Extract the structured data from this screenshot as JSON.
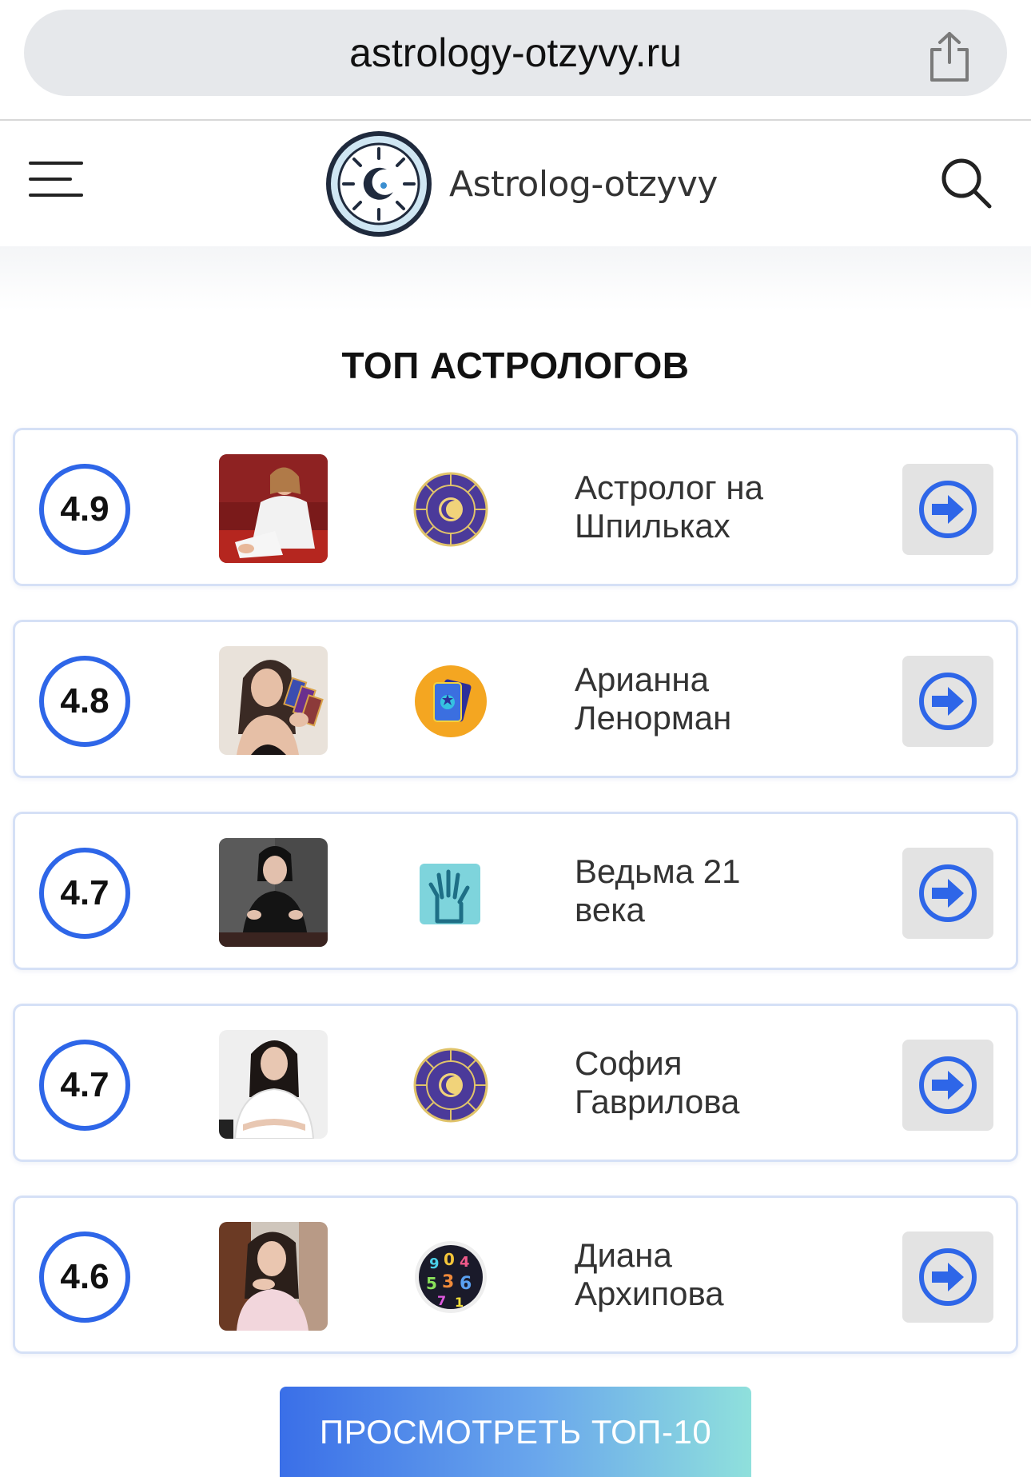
{
  "browser": {
    "url": "astrology-otzyvy.ru"
  },
  "header": {
    "logo_text": "Astrolog-otzyvy"
  },
  "section": {
    "title": "ТОП АСТРОЛОГОВ"
  },
  "astrologers": [
    {
      "rating": "4.9",
      "name_line1": "Астролог на",
      "name_line2": "Шпильках",
      "badge": "zodiac-wheel-icon"
    },
    {
      "rating": "4.8",
      "name_line1": "Арианна",
      "name_line2": "Ленорман",
      "badge": "tarot-cards-icon"
    },
    {
      "rating": "4.7",
      "name_line1": "Ведьма 21",
      "name_line2": "века",
      "badge": "palm-reading-icon"
    },
    {
      "rating": "4.7",
      "name_line1": "София",
      "name_line2": "Гаврилова",
      "badge": "zodiac-wheel-icon"
    },
    {
      "rating": "4.6",
      "name_line1": "Диана",
      "name_line2": "Архипова",
      "badge": "numerology-icon"
    }
  ],
  "cta": {
    "label": "ПРОСМОТРЕТЬ ТОП-10"
  },
  "colors": {
    "accent": "#2e66e8",
    "card_border": "#d5e0f6",
    "button_bg": "#e3e3e3"
  }
}
